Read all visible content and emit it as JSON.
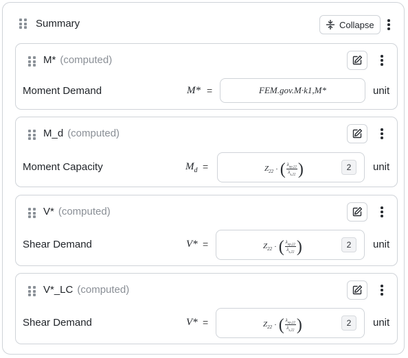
{
  "summary": {
    "title": "Summary",
    "collapse_label": "Collapse"
  },
  "cards": [
    {
      "name": "M*",
      "status": "(computed)",
      "description": "Moment Demand",
      "symbol": "M*",
      "symbol_sub": "",
      "equals": "=",
      "formula_text": "FEM.gov.M·k1,M*",
      "formula_parts": null,
      "badge": "",
      "unit": "unit"
    },
    {
      "name": "M_d",
      "status": "(computed)",
      "description": "Moment Capacity",
      "symbol": "M",
      "symbol_sub": "d",
      "equals": "=",
      "formula_text": "",
      "formula_parts": {
        "lead": "Z",
        "lead_sub": "22",
        "dot": "·",
        "num": "λ",
        "num_sub": "ep,22",
        "den": "λ",
        "den_sub": "s,22"
      },
      "badge": "2",
      "unit": "unit"
    },
    {
      "name": "V*",
      "status": "(computed)",
      "description": "Shear Demand",
      "symbol": "V*",
      "symbol_sub": "",
      "equals": "=",
      "formula_text": "",
      "formula_parts": {
        "lead": "Z",
        "lead_sub": "22",
        "dot": "·",
        "num": "λ",
        "num_sub": "ep,22",
        "den": "λ",
        "den_sub": "s,22"
      },
      "badge": "2",
      "unit": "unit"
    },
    {
      "name": "V*_LC",
      "status": "(computed)",
      "description": "Shear Demand",
      "symbol": "V*",
      "symbol_sub": "",
      "equals": "=",
      "formula_text": "",
      "formula_parts": {
        "lead": "Z",
        "lead_sub": "22",
        "dot": "·",
        "num": "λ",
        "num_sub": "ep,22",
        "den": "λ",
        "den_sub": "s,22"
      },
      "badge": "2",
      "unit": "unit"
    }
  ],
  "icons": {
    "drag": "drag-handle-icon",
    "collapse": "collapse-icon",
    "edit": "edit-icon",
    "more": "more-vertical-icon"
  }
}
